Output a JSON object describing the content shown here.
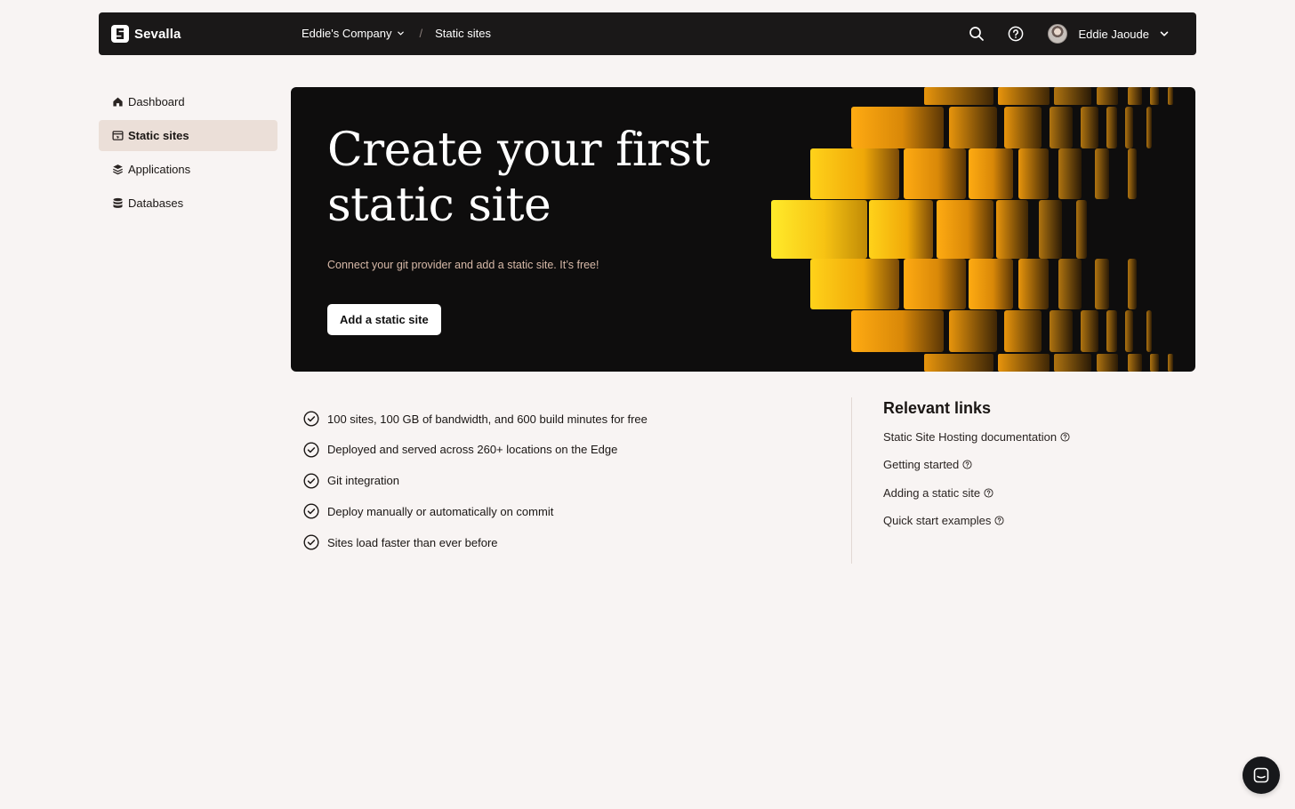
{
  "brand": {
    "name": "Sevalla"
  },
  "breadcrumb": {
    "company": "Eddie's Company",
    "separator": "/",
    "current": "Static sites"
  },
  "user": {
    "name": "Eddie Jaoude"
  },
  "sidebar": {
    "items": [
      {
        "label": "Dashboard",
        "icon": "home-icon"
      },
      {
        "label": "Static sites",
        "icon": "static-site-icon",
        "active": true
      },
      {
        "label": "Applications",
        "icon": "layers-icon"
      },
      {
        "label": "Databases",
        "icon": "database-icon"
      }
    ]
  },
  "hero": {
    "title": "Create your first static site",
    "subtitle": "Connect your git provider and add a static site. It’s free!",
    "cta": "Add a static site"
  },
  "features": [
    "100 sites, 100 GB of bandwidth, and 600 build minutes for free",
    "Deployed and served across 260+ locations on the Edge",
    "Git integration",
    "Deploy manually or automatically on commit",
    "Sites load faster than ever before"
  ],
  "relevant_links": {
    "title": "Relevant links",
    "items": [
      "Static Site Hosting documentation",
      "Getting started",
      "Adding a static site",
      "Quick start examples"
    ]
  },
  "colors": {
    "topbar": "#1a1818",
    "page_background": "#f8f4f3",
    "sidebar_active": "#ebdfd8",
    "hero_background": "#0e0d0d",
    "hero_accent": "#ffc21a"
  }
}
